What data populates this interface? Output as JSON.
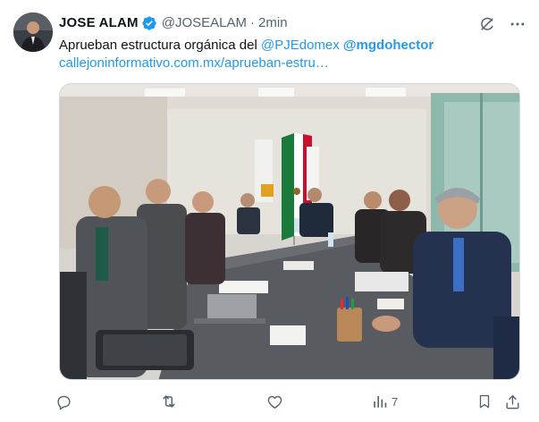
{
  "author": {
    "name": "JOSE ALAM",
    "handle": "@JOSEALAM",
    "separator": "·",
    "time": "2min"
  },
  "tweet": {
    "text_prefix": "Aprueban estructura orgánica del ",
    "mention_1": "@PJEdomex",
    "mention_2": "@mgdohector",
    "link": "callejoninformativo.com.mx/aprueban-estru…"
  },
  "actions": {
    "views_count": "7"
  },
  "icons": {
    "verified": "verified-badge-icon",
    "grok": "grok-icon",
    "more": "more-icon",
    "reply": "reply-icon",
    "retweet": "retweet-icon",
    "like": "like-icon",
    "views": "views-icon",
    "bookmark": "bookmark-icon",
    "share": "share-icon"
  },
  "colors": {
    "accent": "#1d9bf0",
    "text": "#0f1419",
    "secondary": "#536471"
  }
}
